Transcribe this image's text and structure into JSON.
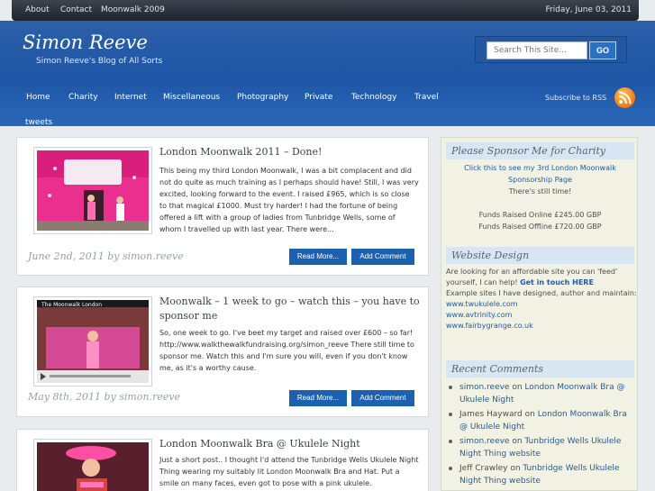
{
  "topbar": {
    "links": [
      "About",
      "Contact",
      "Moonwalk 2009"
    ],
    "date": "Friday, June 03, 2011"
  },
  "header": {
    "title": "Simon Reeve",
    "tagline": "Simon Reeve's Blog of All Sorts",
    "search_placeholder": "Search This Site...",
    "search_button": "GO"
  },
  "nav": {
    "items": [
      "Home",
      "Charity",
      "Internet",
      "Miscellaneous",
      "Photography",
      "Private",
      "Technology",
      "Travel"
    ],
    "overflow_item": "tweets",
    "rss_label": "Subscribe to RSS"
  },
  "posts": [
    {
      "title": "London Moonwalk 2011 – Done!",
      "excerpt": "This being my third London Moonwalk, I was a bit complacent and did not do quite as much training as I perhaps should have!  Still, I was very excited, looking forward to the event. I raised £965, which is so close to that magical £1000.  Must try harder! I had the fortune of being offered a lift with a group of ladies from Tunbridge Wells, some of whom I travelled up with last year. There were...",
      "meta": "June 2nd, 2011 by simon.reeve",
      "read_more": "Read More...",
      "add_comment": "Add Comment"
    },
    {
      "title": "Moonwalk – 1 week to go – watch this – you have to sponsor me",
      "excerpt": "So, one week to go.  I've beet my target and raised over £600 – so far! http://www.walkthewalkfundraising.org/simon_reeve There still time to sponsor me.  Watch this and I'm sure you will, even if you don't know me, as it's a worthy cause.",
      "meta": "May 8th, 2011 by simon.reeve",
      "read_more": "Read More...",
      "add_comment": "Add Comment",
      "video_caption": "The Moonwalk London"
    },
    {
      "title": "London Moonwalk Bra @ Ukulele Night",
      "excerpt": "Just a short post..  I thought I'd attend the Tunbridge Wells Ukulele Night Thing wearing my suitably lit London Moonwalk Bra and Hat.  Put a smile on many faces, even got to pose with a pink ukulele."
    }
  ],
  "sidebar": {
    "sponsor": {
      "title": "Please Sponsor Me for Charity",
      "link_line1": "Click this to see my 3rd London Moonwalk",
      "link_line2": "Sponsorship Page",
      "note": "There's still time!",
      "online": "Funds Raised Online £245.00 GBP",
      "offline": "Funds Raised Offline £720.00 GBP"
    },
    "design": {
      "title": "Website Design",
      "text_a": "Are looking for an affordable site you can 'feed' yourself, I can help! ",
      "cta": "Get in touch HERE",
      "text_b": "Example sites I have designed, author and maintain:",
      "sites": [
        "www.twukulele.com",
        "www.avtrinity.com",
        "www.fairbygrange.co.uk"
      ]
    },
    "comments": {
      "title": "Recent Comments",
      "items": [
        {
          "author": "simon.reeve",
          "on": " on ",
          "post": "London Moonwalk Bra @ Ukulele Night",
          "author_link": true
        },
        {
          "author": "James Hayward",
          "on": " on ",
          "post": "London Moonwalk Bra @ Ukulele Night",
          "author_link": false
        },
        {
          "author": "simon.reeve",
          "on": " on ",
          "post": "Tunbridge Wells Ukulele Night Thing website",
          "author_link": true
        },
        {
          "author": "Jeff Crawley",
          "on": " on ",
          "post": "Tunbridge Wells Ukulele Night Thing website",
          "author_link": false
        }
      ]
    }
  },
  "colors": {
    "header_blue": "#1f56a6",
    "button_blue": "#1c61b0",
    "link_blue": "#1f5ca5",
    "rss_orange": "#f17a0e"
  }
}
